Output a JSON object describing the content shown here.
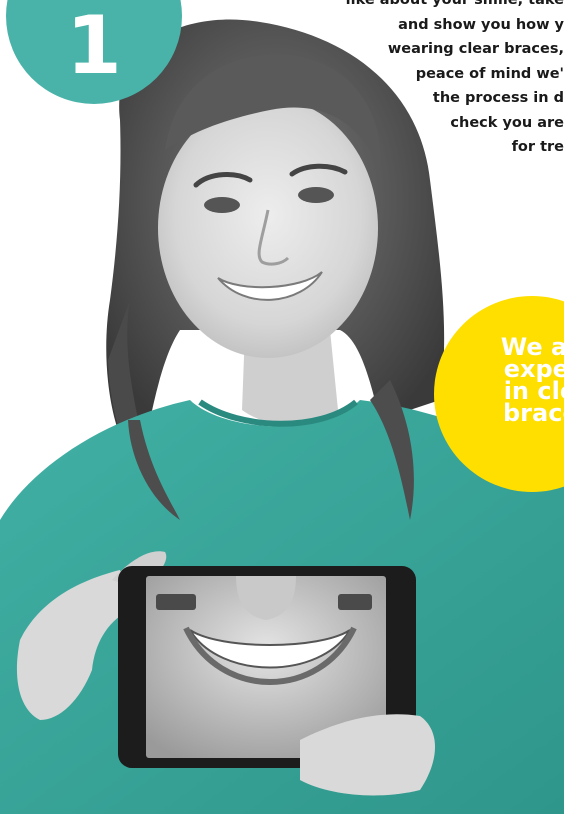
{
  "step_badge": {
    "number": "1",
    "color": "#4ab3a9"
  },
  "intro": {
    "lines": [
      "like about your smile, take",
      "and show you how y",
      "wearing clear braces,",
      "peace of mind we'",
      "the process in d",
      "check you are",
      "for tre"
    ]
  },
  "expert_badge": {
    "lines": [
      "We are",
      "expert",
      "in clea",
      "braces"
    ],
    "color": "#ffdf00"
  },
  "photo": {
    "subject": "woman-holding-tablet",
    "sweater_color": "#3aa89c",
    "tablet": {
      "left_button_icon": "back-arrow-icon",
      "right_button_icon": "menu-button-icon",
      "screen_content": "smile-closeup"
    }
  }
}
